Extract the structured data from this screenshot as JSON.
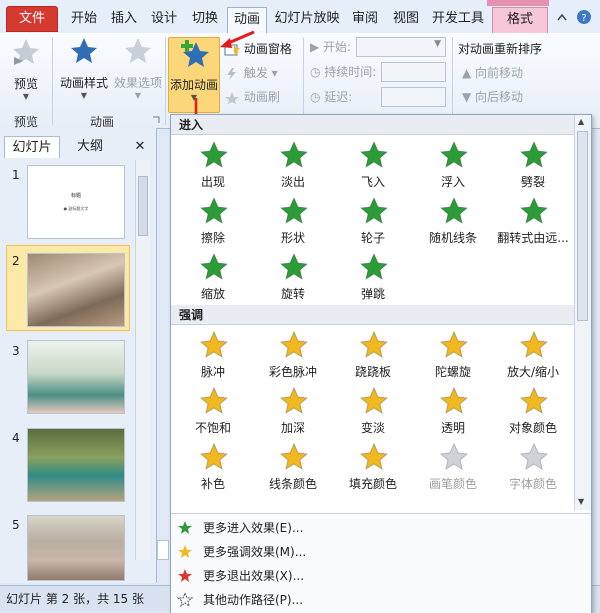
{
  "tabs": {
    "file": "文件",
    "home": "开始",
    "insert": "插入",
    "design": "设计",
    "transitions": "切换",
    "animations": "动画",
    "slideshow": "幻灯片放映",
    "review": "审阅",
    "view": "视图",
    "developer": "开发工具",
    "format": "格式"
  },
  "ribbon": {
    "preview": {
      "label": "预览",
      "group": "预览"
    },
    "styles": {
      "label": "动画样式",
      "options": "效果选项",
      "group": "动画"
    },
    "add": {
      "label": "添加动画"
    },
    "pane": "动画窗格",
    "trigger": "触发",
    "painter": "动画刷",
    "start": "开始:",
    "duration": "持续时间:",
    "delay": "延迟:",
    "reorder": "对动画重新排序",
    "forward": "向前移动",
    "backward": "向后移动"
  },
  "panel": {
    "tab_slides": "幻灯片",
    "tab_outline": "大纲",
    "close": "✕",
    "slides": [
      {
        "n": "1",
        "title": "标题",
        "sub": "● 副标题文字"
      },
      {
        "n": "2"
      },
      {
        "n": "3"
      },
      {
        "n": "4"
      },
      {
        "n": "5"
      }
    ]
  },
  "status": {
    "text": "幻灯片 第 2 张，共 15 张"
  },
  "gallery": {
    "entrance": {
      "title": "进入",
      "items": [
        "出现",
        "淡出",
        "飞入",
        "浮入",
        "劈裂",
        "擦除",
        "形状",
        "轮子",
        "随机线条",
        "翻转式由远...",
        "缩放",
        "旋转",
        "弹跳"
      ]
    },
    "emphasis": {
      "title": "强调",
      "items": [
        "脉冲",
        "彩色脉冲",
        "跷跷板",
        "陀螺旋",
        "放大/缩小",
        "不饱和",
        "加深",
        "变淡",
        "透明",
        "对象颜色",
        "补色",
        "线条颜色",
        "填充颜色",
        "画笔颜色",
        "字体颜色"
      ]
    },
    "menu": [
      "更多进入效果(E)...",
      "更多强调效果(M)...",
      "更多退出效果(X)...",
      "其他动作路径(P)..."
    ]
  },
  "colors": {
    "green": "#2e9b3a",
    "gold": "#f1b81f",
    "red": "#d6392f",
    "accent": "#2f6db5"
  }
}
